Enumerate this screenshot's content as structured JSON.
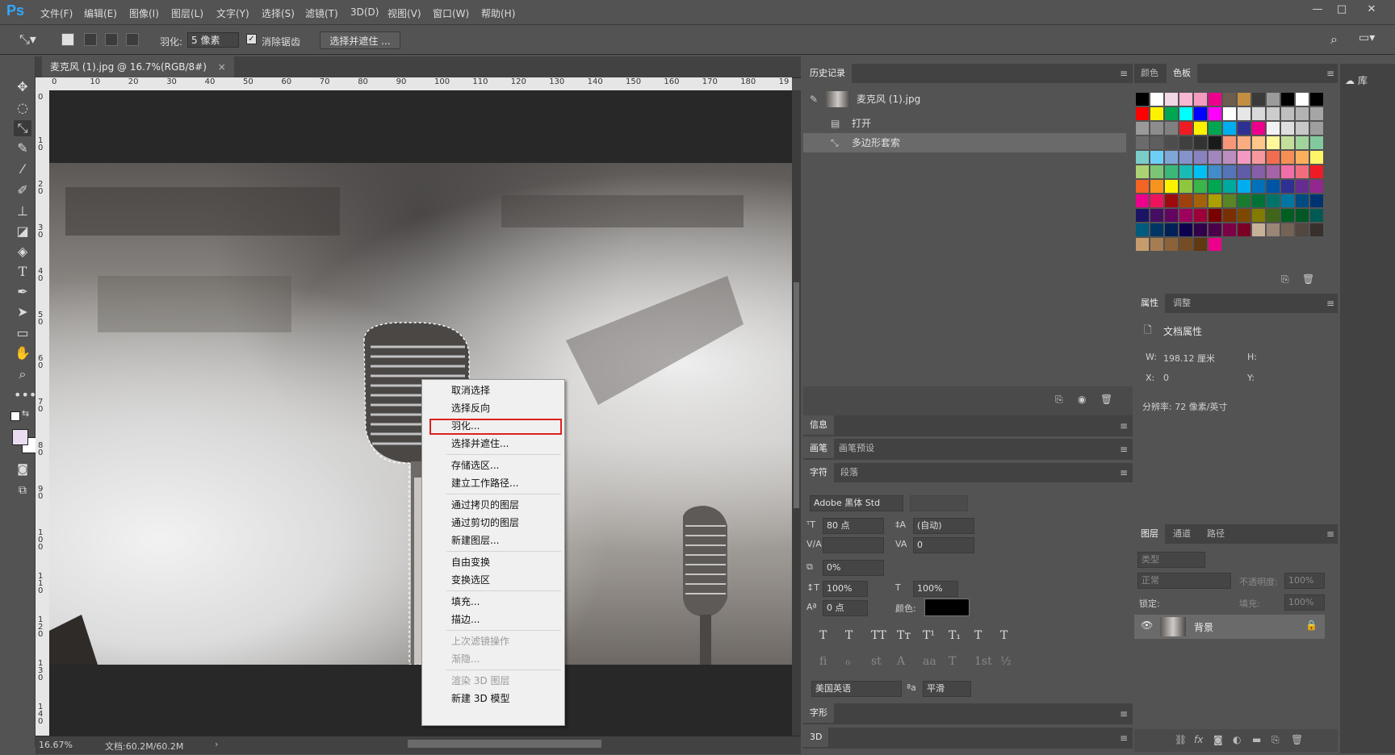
{
  "app": {
    "logo": "Ps"
  },
  "menu": [
    "文件(F)",
    "编辑(E)",
    "图像(I)",
    "图层(L)",
    "文字(Y)",
    "选择(S)",
    "滤镜(T)",
    "3D(D)",
    "视图(V)",
    "窗口(W)",
    "帮助(H)"
  ],
  "window_controls": {
    "minimize": "—",
    "maximize": "□",
    "close": "✕"
  },
  "options": {
    "feather_label": "羽化:",
    "feather_value": "5 像素",
    "antialias_label": "消除锯齿",
    "antialias_checked": "✓",
    "select_mask_button": "选择并遮住 ..."
  },
  "document": {
    "tab_title": "麦克风 (1).jpg @ 16.7%(RGB/8#)",
    "tab_close": "×",
    "zoom": "16.67%",
    "doc_size": "文档:60.2M/60.2M",
    "ruler_top": [
      "0",
      "10",
      "20",
      "30",
      "40",
      "50",
      "60",
      "70",
      "80",
      "90",
      "100",
      "110",
      "120",
      "130",
      "140",
      "150",
      "160",
      "170",
      "180",
      "19"
    ],
    "ruler_left": [
      "0",
      "1 0",
      "2 0",
      "3 0",
      "4 0",
      "5 0",
      "6 0",
      "7 0",
      "8 0",
      "9 0",
      "1 0 0",
      "1 1 0",
      "1 2 0",
      "1 3 0",
      "1 4 0"
    ]
  },
  "context_menu": {
    "items": [
      {
        "label": "取消选择",
        "enabled": true
      },
      {
        "label": "选择反向",
        "enabled": true
      },
      {
        "label": "羽化...",
        "enabled": true,
        "highlighted": true
      },
      {
        "label": "选择并遮住...",
        "enabled": true
      },
      {
        "label": "存储选区...",
        "enabled": true
      },
      {
        "label": "建立工作路径...",
        "enabled": true
      },
      {
        "label": "通过拷贝的图层",
        "enabled": true
      },
      {
        "label": "通过剪切的图层",
        "enabled": true
      },
      {
        "label": "新建图层...",
        "enabled": true
      },
      {
        "label": "自由变换",
        "enabled": true
      },
      {
        "label": "变换选区",
        "enabled": true
      },
      {
        "label": "填充...",
        "enabled": true
      },
      {
        "label": "描边...",
        "enabled": true
      },
      {
        "label": "上次滤镜操作",
        "enabled": false
      },
      {
        "label": "渐隐...",
        "enabled": false
      },
      {
        "label": "渲染 3D 图层",
        "enabled": false
      },
      {
        "label": "新建 3D 模型",
        "enabled": true
      }
    ]
  },
  "history": {
    "tab": "历史记录",
    "snapshot": "麦克风 (1).jpg",
    "steps": [
      "打开",
      "多边形套索"
    ]
  },
  "panels": {
    "info": "信息",
    "brush": "画笔",
    "brush_presets": "画笔预设",
    "character": "字符",
    "paragraph": "段落",
    "glyphs": "字形",
    "three_d": "3D",
    "color": "颜色",
    "swatches": "色板",
    "properties": "属性",
    "adjustments": "调整",
    "layers": "图层",
    "channels": "通道",
    "paths": "路径",
    "library": "库"
  },
  "character": {
    "font_family": "Adobe 黑体 Std",
    "font_size": "80 点",
    "leading": "(自动)",
    "kerning": "",
    "tracking": "0",
    "scale_percent": "0%",
    "vertical_scale": "100%",
    "horizontal_scale": "100%",
    "baseline_shift": "0 点",
    "color_label": "颜色:",
    "language": "美国英语",
    "aa_label": "ªa",
    "antialias": "平滑",
    "styles": [
      "T",
      "T",
      "TT",
      "Tт",
      "T¹",
      "T₁",
      "T",
      "T"
    ],
    "opentype": [
      "fi",
      "ℴ",
      "st",
      "A",
      "aa",
      "T",
      "1st",
      "½"
    ]
  },
  "properties": {
    "title": "文档属性",
    "w_label": "W:",
    "w_value": "198.12 厘米",
    "h_label": "H:",
    "x_label": "X:",
    "x_value": "0",
    "y_label": "Y:",
    "resolution": "分辨率: 72 像素/英寸"
  },
  "layers": {
    "kind_label": "类型",
    "blend_mode": "正常",
    "opacity_label": "不透明度:",
    "opacity_value": "100%",
    "lock_label": "锁定:",
    "fill_label": "填充:",
    "fill_value": "100%",
    "items": [
      {
        "name": "背景"
      }
    ]
  },
  "swatch_colors": [
    "#000000",
    "#ffffff",
    "#f2d7e7",
    "#f7b6d2",
    "#f49ac1",
    "#ec008c",
    "#6d5d4e",
    "#c38e3f",
    "#3a3a3a",
    "#9b9b9b",
    "#000000",
    "#ffffff",
    "#000000",
    "#ff0000",
    "#fff200",
    "#00a651",
    "#00ffff",
    "#0000ff",
    "#ff00ff",
    "#ffffff",
    "#e6e6e6",
    "#d9d9d9",
    "#cccccc",
    "#bfbfbf",
    "#b3b3b3",
    "#a6a6a6",
    "#999999",
    "#8c8c8c",
    "#808080",
    "#ed1c24",
    "#fff200",
    "#00a651",
    "#00aeef",
    "#2e3192",
    "#ec008c",
    "#f2f2f2",
    "#dedede",
    "#c7c7c7",
    "#9e9e9e",
    "#6b6b6b",
    "#5e5e5e",
    "#4d4d4d",
    "#404040",
    "#333333",
    "#1a1a1a",
    "#f7977a",
    "#f9ad81",
    "#fdc68a",
    "#fff79a",
    "#c4df9b",
    "#a3d39c",
    "#82ca9d",
    "#7bcdc8",
    "#6ecff6",
    "#7ea7d8",
    "#8493ca",
    "#8882be",
    "#a187be",
    "#bc8dbf",
    "#f49ac2",
    "#f6989d",
    "#f26c4f",
    "#f68e56",
    "#fbaf5d",
    "#fff568",
    "#acd373",
    "#7cc576",
    "#3bb878",
    "#1abbb4",
    "#00bff3",
    "#438ccb",
    "#5574b9",
    "#605ca8",
    "#855fa8",
    "#a763a8",
    "#f06eaa",
    "#f26d7d",
    "#ed1c24",
    "#f26522",
    "#f7941d",
    "#fff200",
    "#8dc63f",
    "#39b54a",
    "#00a651",
    "#00a99d",
    "#00aeef",
    "#0072bc",
    "#0054a6",
    "#2e3192",
    "#662d91",
    "#92278f",
    "#ec008c",
    "#ed145b",
    "#9e0b0f",
    "#a0410d",
    "#a3620a",
    "#aba000",
    "#598527",
    "#197b30",
    "#007236",
    "#00746b",
    "#0076a3",
    "#004b80",
    "#003471",
    "#1b1464",
    "#440e62",
    "#630460",
    "#9e005d",
    "#9e0039",
    "#790000",
    "#7b2e00",
    "#7d4900",
    "#827b00",
    "#406618",
    "#005e20",
    "#005826",
    "#005952",
    "#005b7f",
    "#003663",
    "#002157",
    "#0d004c",
    "#32004b",
    "#4b0049",
    "#7b0046",
    "#7a0026",
    "#c7b299",
    "#998675",
    "#736357",
    "#534741",
    "#37302d",
    "#c69c6d",
    "#a67c52",
    "#8c6239",
    "#754c24",
    "#603913",
    "#ec008c"
  ]
}
